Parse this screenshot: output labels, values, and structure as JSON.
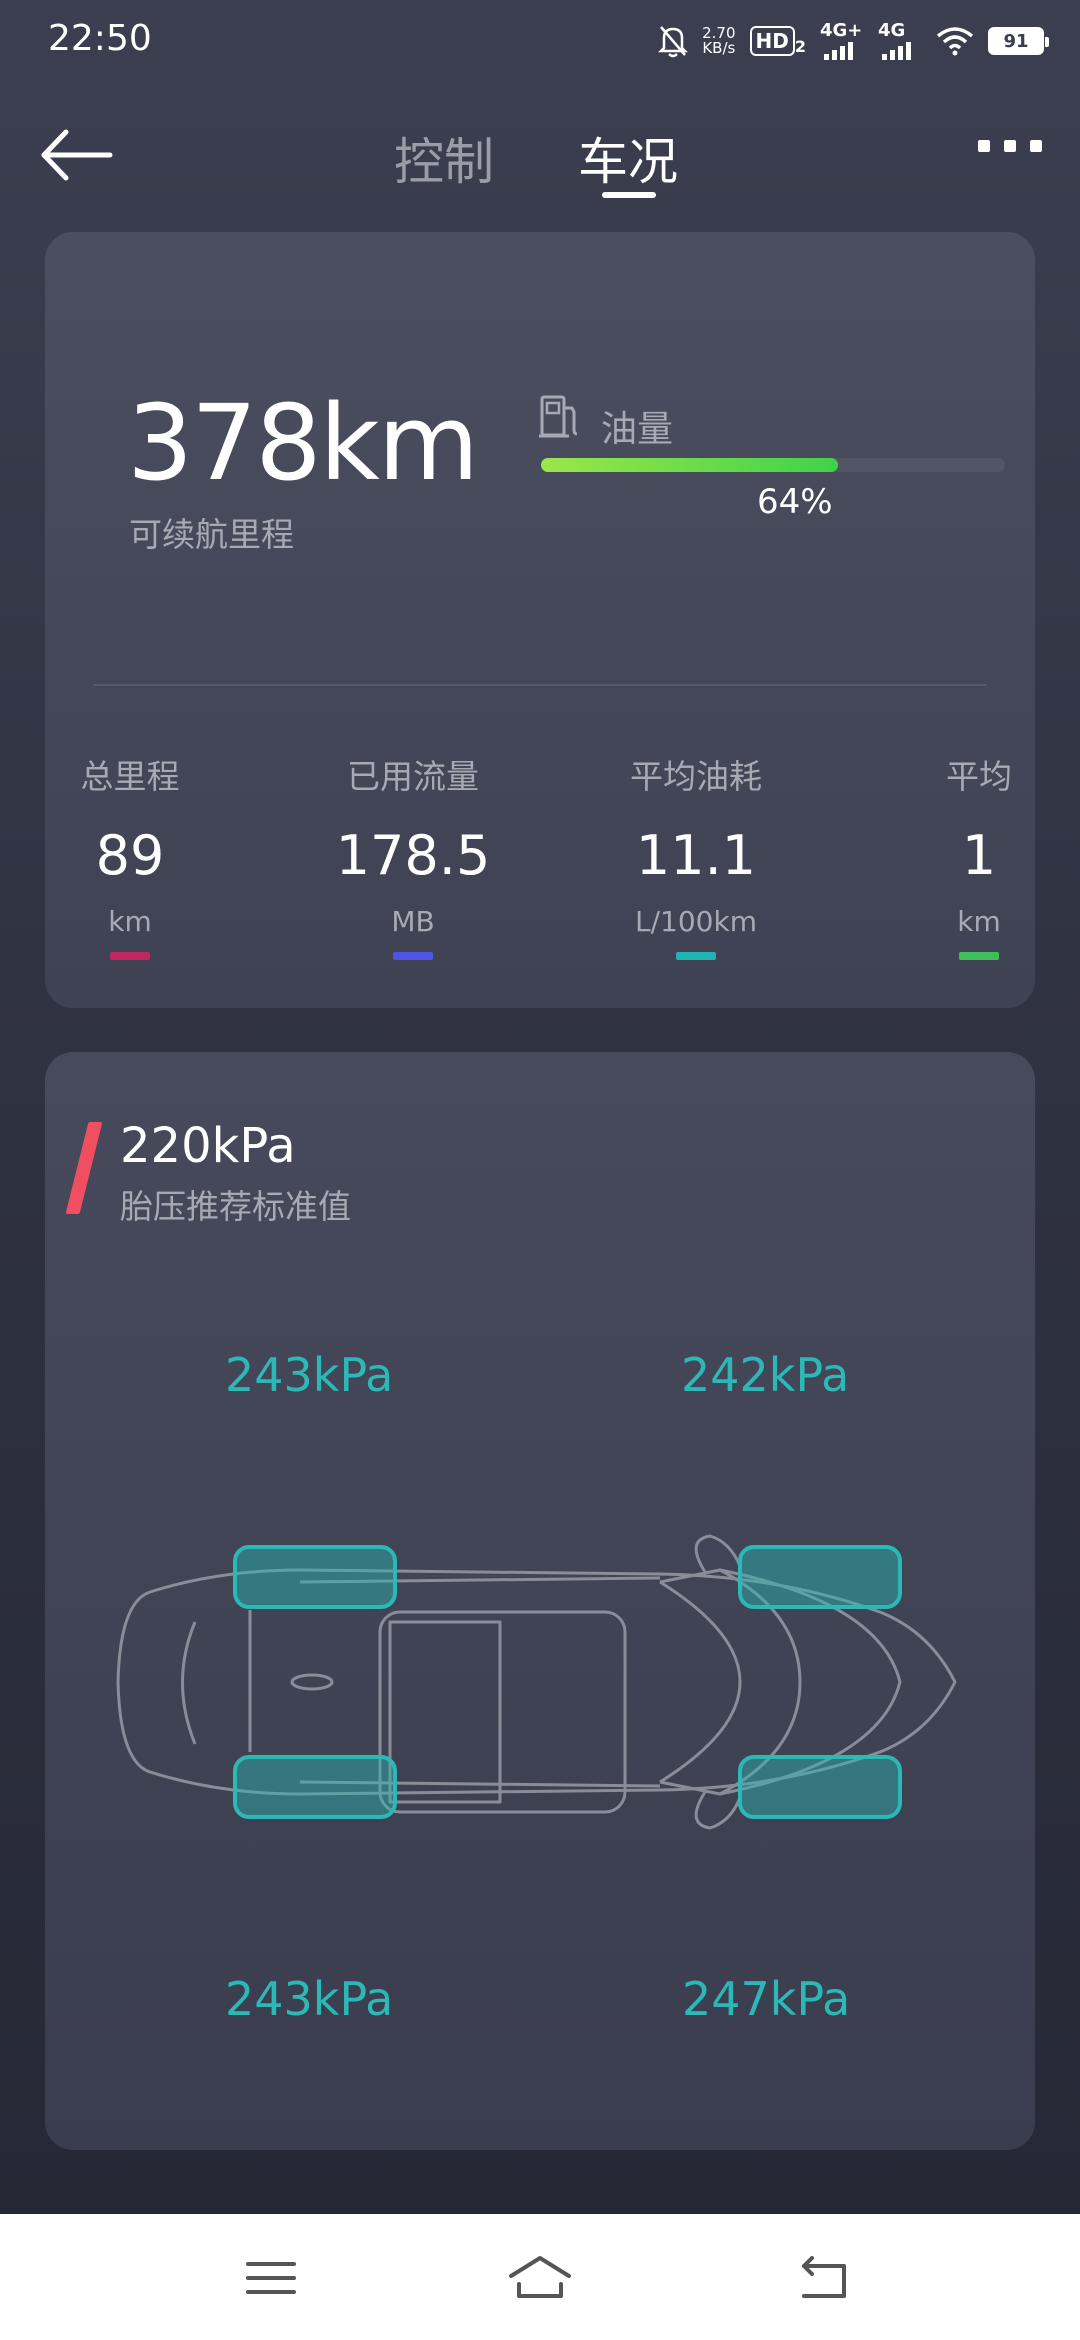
{
  "status_bar": {
    "time": "22:50",
    "net_speed": "2.70",
    "net_speed_unit": "KB/s",
    "hd_label": "HD",
    "hd_sub": "2",
    "sim1_label": "4G+",
    "sim2_label": "4G",
    "battery": "91"
  },
  "header": {
    "tab_control": "控制",
    "tab_status": "车况",
    "active_tab": "车况"
  },
  "range_card": {
    "range_value": "378km",
    "range_label": "可续航里程",
    "fuel_label": "油量",
    "fuel_percent": "64%",
    "fuel_level": 0.64
  },
  "stats": [
    {
      "title": "总里程",
      "value": "89",
      "unit": "km",
      "color": "#c2275f"
    },
    {
      "title": "已用流量",
      "value": "178.5",
      "unit": "MB",
      "color": "#4d55e6"
    },
    {
      "title": "平均油耗",
      "value": "11.1",
      "unit": "L/100km",
      "color": "#20b4b4"
    },
    {
      "title": "平均",
      "value": "1",
      "unit": "km",
      "color": "#3fbf5a"
    }
  ],
  "tire_card": {
    "recommended_value": "220kPa",
    "recommended_label": "胎压推荐标准值",
    "front_left": "243kPa",
    "front_right": "242kPa",
    "rear_left": "243kPa",
    "rear_right": "247kPa",
    "tire_color": "#2bb8b6"
  },
  "nav": {
    "menu_icon": "menu-icon",
    "home_icon": "home-icon",
    "back_icon": "back-nav-icon"
  }
}
